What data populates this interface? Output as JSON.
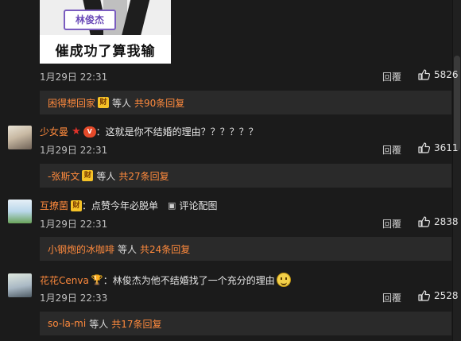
{
  "image_post": {
    "name_tag": "林俊杰",
    "caption": "催成功了算我输",
    "time": "1月29日 22:31",
    "reply_label": "回覆",
    "likes": "5826",
    "sub": {
      "names": "困得想回家",
      "etc": "等人",
      "count": "共90条回复"
    }
  },
  "comments": [
    {
      "user": "少女曼",
      "text": "：这就是你不结婚的理由？？？？？？",
      "time": "1月29日 22:31",
      "reply_label": "回覆",
      "likes": "3611",
      "sub": {
        "names": "-张斯文",
        "etc": "等人",
        "count": "共27条回复"
      }
    },
    {
      "user": "互撩菌",
      "text": "：点赞今年必脱单",
      "pic_link": "评论配图",
      "time": "1月29日 22:31",
      "reply_label": "回覆",
      "likes": "2838",
      "sub": {
        "names": "小钢炮的冰咖啡",
        "etc": "等人",
        "count": "共24条回复"
      }
    },
    {
      "user": "花花Cenva",
      "text": "：林俊杰为他不结婚找了一个充分的理由",
      "time": "1月29日 22:33",
      "reply_label": "回覆",
      "likes": "2528",
      "sub": {
        "names": "so-la-mi",
        "etc": "等人",
        "count": "共17条回复"
      }
    }
  ],
  "icons": {
    "thumb": "thumbs-up-icon",
    "vip_badge": "verified-badge-icon",
    "star": "star-icon",
    "picture": "picture-icon",
    "smile": "smile-emoji-icon"
  },
  "colors": {
    "background": "#1b1b1b",
    "subbox": "#2a2a2a",
    "accent": "#ff8a3d",
    "text": "#e6e6e6"
  }
}
